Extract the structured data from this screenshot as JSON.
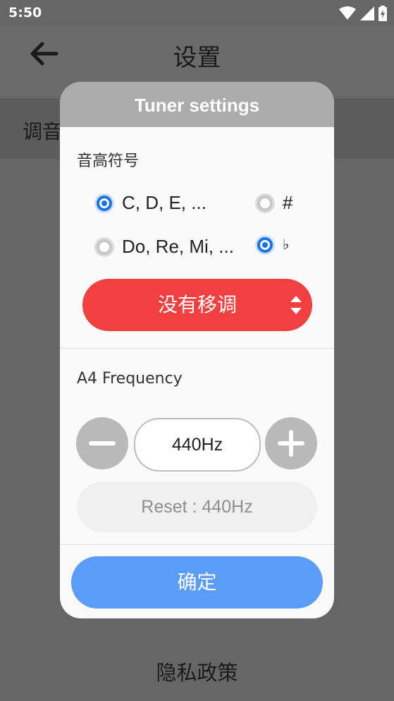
{
  "status_bar": {
    "time": "5:50",
    "icons": [
      "wifi-icon",
      "signal-icon",
      "battery-icon"
    ]
  },
  "app_bar": {
    "title": "设置",
    "back_icon": "arrow-left-icon"
  },
  "background": {
    "row_label": "调音",
    "privacy_label": "隐私政策"
  },
  "dialog": {
    "title": "Tuner settings",
    "note_names": {
      "label": "音高符号",
      "options_left": [
        {
          "label": "C, D, E, ...",
          "selected": true
        },
        {
          "label": "Do, Re, Mi, ...",
          "selected": false
        }
      ],
      "options_right": [
        {
          "label": "#",
          "selected": false
        },
        {
          "label": "♭",
          "selected": true
        }
      ]
    },
    "transpose": {
      "value": "没有移调",
      "icon": "up-down-arrows-icon"
    },
    "frequency": {
      "label": "A4 Frequency",
      "value": "440Hz",
      "decrease_icon": "minus-icon",
      "increase_icon": "plus-icon",
      "reset_label": "Reset : 440Hz"
    },
    "confirm_label": "确定"
  },
  "colors": {
    "accent": "#1a73e8",
    "transpose_bg": "#f24040",
    "confirm_bg": "#5b9cf8",
    "header_bg": "#acacac",
    "scrim": "#666666"
  }
}
